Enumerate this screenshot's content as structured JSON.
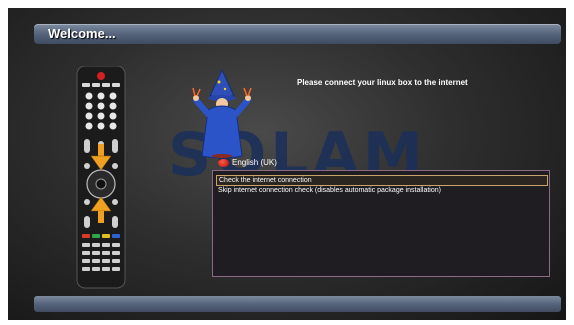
{
  "header": {
    "title": "Welcome..."
  },
  "watermark": {
    "text": "SOLAM"
  },
  "prompt": {
    "text": "Please connect your linux box to the internet"
  },
  "language": {
    "label": "English (UK)",
    "icon": "flag-uk-icon"
  },
  "options": {
    "items": [
      {
        "label": "Check the internet connection",
        "selected": true
      },
      {
        "label": "Skip internet connection check (disables automatic package installation)",
        "selected": false
      }
    ]
  },
  "colors": {
    "bar_accent": "#56657c",
    "selection_border": "#c9a46a",
    "list_border": "#8a6a84",
    "remote_arrow": "#f0a020"
  }
}
